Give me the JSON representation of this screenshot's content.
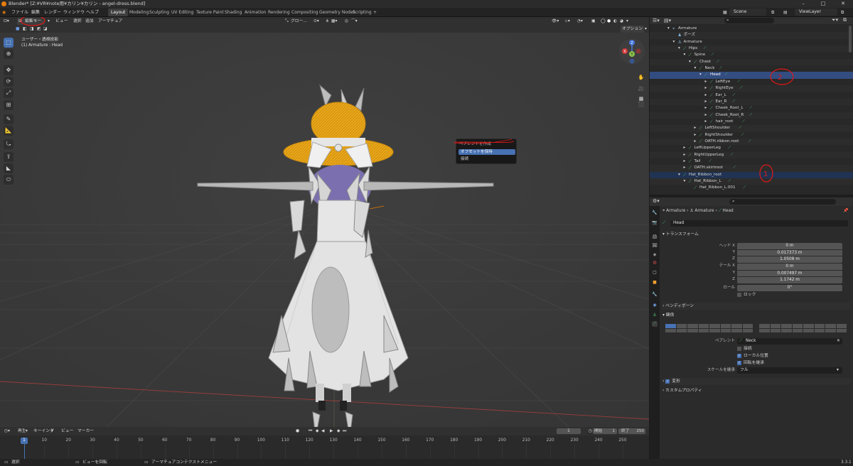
{
  "titlebar": {
    "title": "Blender* [Z:¥VR¥note用¥カリン¥カリン - angel-dress.blend]"
  },
  "topbar": {
    "menus": [
      "ファイル",
      "編集",
      "レンダー",
      "ウィンドウ",
      "ヘルプ"
    ],
    "workspaces": [
      "Layout",
      "Modeling",
      "Sculpting",
      "UV Editing",
      "Texture Paint",
      "Shading",
      "Animation",
      "Rendering",
      "Compositing",
      "Geometry Nodes",
      "Scripting",
      "+"
    ],
    "active_workspace": "Layout",
    "scene": "Scene",
    "view_layer": "ViewLayer"
  },
  "viewport": {
    "header": {
      "mode": "編集モード",
      "menus": [
        "ビュー",
        "選択",
        "追加",
        "アーマチュア"
      ],
      "orientation": "グロー...",
      "options": "オプション"
    },
    "overlay_text": {
      "line1": "ユーザー・透視投影",
      "line2": "(1) Armature : Head"
    },
    "tools": [
      "select-box",
      "cursor",
      "move",
      "rotate",
      "scale",
      "transform",
      "annotate",
      "measure",
      "roll",
      "extrude",
      "bone-size",
      "bone-envelope"
    ],
    "nav_tools": [
      "zoom",
      "camera",
      "grid-view",
      "perspective"
    ],
    "gizmo": {
      "z": "Z",
      "y": "Y",
      "x": "X"
    }
  },
  "context_menu": {
    "title": "ペアレントを作成",
    "items": [
      "オフセットを保持",
      "接続"
    ],
    "active_index": 0
  },
  "annotations": {
    "circle1": "1",
    "circle2": "2"
  },
  "outliner": {
    "search_placeholder": "",
    "rows": [
      {
        "label": "Armature",
        "indent": 2,
        "arrow": "▾",
        "icon": "armature"
      },
      {
        "label": "ポーズ",
        "indent": 3,
        "arrow": "",
        "icon": "pose"
      },
      {
        "label": "Armature",
        "indent": 3,
        "arrow": "▾",
        "icon": "armature-data"
      },
      {
        "label": "Hips",
        "indent": 4,
        "arrow": "▾",
        "icon": "bone"
      },
      {
        "label": "Spine",
        "indent": 5,
        "arrow": "▾",
        "icon": "bone"
      },
      {
        "label": "Chest",
        "indent": 6,
        "arrow": "▾",
        "icon": "bone"
      },
      {
        "label": "Neck",
        "indent": 7,
        "arrow": "▾",
        "icon": "bone"
      },
      {
        "label": "Head",
        "indent": 8,
        "arrow": "▾",
        "icon": "bone",
        "selected": true
      },
      {
        "label": "LeftEye",
        "indent": 9,
        "arrow": "▸",
        "icon": "bone"
      },
      {
        "label": "RightEye",
        "indent": 9,
        "arrow": "▸",
        "icon": "bone"
      },
      {
        "label": "Ear_L",
        "indent": 9,
        "arrow": "▸",
        "icon": "bone"
      },
      {
        "label": "Ear_R",
        "indent": 9,
        "arrow": "▸",
        "icon": "bone"
      },
      {
        "label": "Cheek_Root_L",
        "indent": 9,
        "arrow": "▸",
        "icon": "bone"
      },
      {
        "label": "Cheek_Root_R",
        "indent": 9,
        "arrow": "▸",
        "icon": "bone"
      },
      {
        "label": "hair_root",
        "indent": 9,
        "arrow": "▸",
        "icon": "bone"
      },
      {
        "label": "LeftShoulder",
        "indent": 7,
        "arrow": "▸",
        "icon": "bone"
      },
      {
        "label": "RightShoulder",
        "indent": 7,
        "arrow": "▸",
        "icon": "bone"
      },
      {
        "label": "OATH.ribbon.root",
        "indent": 7,
        "arrow": "▸",
        "icon": "bone"
      },
      {
        "label": "LeftUpperLeg",
        "indent": 5,
        "arrow": "▸",
        "icon": "bone"
      },
      {
        "label": "RightUpperLeg",
        "indent": 5,
        "arrow": "▸",
        "icon": "bone"
      },
      {
        "label": "Tail",
        "indent": 5,
        "arrow": "▸",
        "icon": "bone"
      },
      {
        "label": "OATH.skirtroot",
        "indent": 5,
        "arrow": "▸",
        "icon": "bone"
      },
      {
        "label": "Hat_Ribbon_root",
        "indent": 4,
        "arrow": "▾",
        "icon": "bone-data",
        "highlight": true
      },
      {
        "label": "Hat_Ribbon_L",
        "indent": 5,
        "arrow": "▾",
        "icon": "bone"
      },
      {
        "label": "Hat_Ribbon_L.001",
        "indent": 6,
        "arrow": "",
        "icon": "bone"
      }
    ]
  },
  "properties": {
    "breadcrumb": [
      "Armature",
      "Armature",
      "Head"
    ],
    "bone_name": "Head",
    "transform": {
      "title": "トランスフォーム",
      "head_label": "ヘッド X",
      "tail_label": "テール X",
      "head": [
        "0 m",
        "0.017373 m",
        "1.0508 m"
      ],
      "tail": [
        "0 m",
        "0.007497 m",
        "1.1742 m"
      ],
      "axes": [
        "Y",
        "Z"
      ],
      "roll_label": "ロール",
      "roll": "0°",
      "lock_label": "ロック"
    },
    "sections": {
      "bendy": "ベンディボーン",
      "relations": "関係",
      "deform": "変形",
      "custom": "カスタムプロパティ"
    },
    "relations": {
      "parent_label": "ペアレント",
      "parent_value": "Neck",
      "connect_label": "接続",
      "local_label": "ローカル位置",
      "rotation_label": "回転を継承",
      "scale_label": "スケールを継承",
      "scale_value": "フル"
    }
  },
  "timeline": {
    "menus": [
      "再生",
      "キーイング",
      "ビュー",
      "マーカー"
    ],
    "current_frame": "1",
    "start_label": "開始",
    "start": "1",
    "end_label": "終了",
    "end": "250",
    "ticks": [
      "10",
      "20",
      "30",
      "40",
      "50",
      "60",
      "70",
      "80",
      "90",
      "100",
      "110",
      "120",
      "130",
      "140",
      "150",
      "160",
      "170",
      "180",
      "190",
      "200",
      "210",
      "220",
      "230",
      "240",
      "250"
    ],
    "cursor_label": "1"
  },
  "statusbar": {
    "select": "選択",
    "rotate": "ビューを回転",
    "context": "アーマチュアコンテクストメニュー",
    "version": "3.3.1"
  }
}
